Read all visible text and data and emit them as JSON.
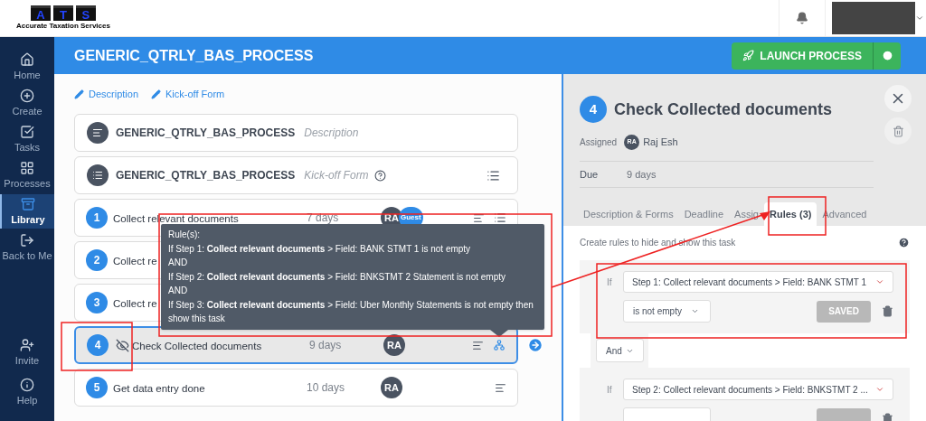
{
  "logo": {
    "letters": [
      "A",
      "T",
      "S"
    ],
    "tagline": "Accurate Taxation Services"
  },
  "sidebar": {
    "items": [
      {
        "kind": "home",
        "label": "Home",
        "selected": false
      },
      {
        "kind": "create",
        "label": "Create",
        "selected": false
      },
      {
        "kind": "tasks",
        "label": "Tasks",
        "selected": false
      },
      {
        "kind": "processes",
        "label": "Processes",
        "selected": false
      },
      {
        "kind": "library",
        "label": "Library",
        "selected": true
      },
      {
        "kind": "back",
        "label": "Back to Me",
        "selected": false
      }
    ],
    "bottom_items": [
      {
        "kind": "invite",
        "label": "Invite"
      },
      {
        "kind": "help",
        "label": "Help"
      }
    ]
  },
  "header": {
    "title": "GENERIC_QTRLY_BAS_PROCESS",
    "launch_button": "LAUNCH PROCESS"
  },
  "links": [
    "Description",
    "Kick-off Form"
  ],
  "steps": [
    {
      "kind": "description",
      "name": "GENERIC_QTRLY_BAS_PROCESS",
      "sublabel": "Description"
    },
    {
      "kind": "form",
      "name": "GENERIC_QTRLY_BAS_PROCESS",
      "sublabel": "Kick-off Form"
    },
    {
      "kind": "task",
      "number": "1",
      "name": "Collect relevant documents",
      "due": "7 days",
      "assignees": [
        "RA",
        "Guest"
      ],
      "hidden": false,
      "has_form": true,
      "has_rules": false,
      "selected": false
    },
    {
      "kind": "task",
      "number": "2",
      "name": "Collect re",
      "hidden": false,
      "selected": false
    },
    {
      "kind": "task",
      "number": "3",
      "name": "Collect re",
      "hidden": false,
      "selected": false
    },
    {
      "kind": "task",
      "number": "4",
      "name": "Check Collected documents",
      "due": "9 days",
      "assignees": [
        "RA"
      ],
      "hidden": true,
      "has_form": false,
      "has_rules": true,
      "selected": true
    },
    {
      "kind": "task",
      "number": "5",
      "name": "Get data entry done",
      "due": "10 days",
      "assignees": [
        "RA"
      ],
      "hidden": false,
      "has_form": false,
      "has_rules": false,
      "selected": false
    }
  ],
  "tooltip": {
    "title": "Rule(s):",
    "lines": [
      "If Step 1: **Collect relevant documents** > Field: BANK STMT 1 is not empty",
      "AND",
      "If Step 2: **Collect relevant documents** > Field: BNKSTMT 2 Statement is not empty",
      "AND",
      "If Step 3: **Collect relevant documents** > Field: Uber Monthly Statements is not empty then show this task"
    ]
  },
  "panel": {
    "number": "4",
    "title": "Check Collected documents",
    "assigned_label": "Assigned",
    "assignee_initials": "RA",
    "assignee_name": "Raj Esh",
    "due_label": "Due",
    "due_value": "9 days",
    "tabs": [
      {
        "label": "Description & Forms",
        "selected": false
      },
      {
        "label": "Deadline",
        "selected": false
      },
      {
        "label": "Assig",
        "selected": false
      },
      {
        "label": "Rules (3)",
        "selected": true
      },
      {
        "label": "Advanced",
        "selected": false
      }
    ],
    "hint": "Create rules to hide and show this task",
    "rules": [
      {
        "if": "If",
        "field": "Step 1: Collect relevant documents > Field: BANK STMT 1",
        "condition": "is not empty",
        "button": "SAVED"
      },
      {
        "if": "If",
        "field": "Step 2: Collect relevant documents > Field: BNKSTMT 2 ..."
      }
    ],
    "connector": "And"
  }
}
